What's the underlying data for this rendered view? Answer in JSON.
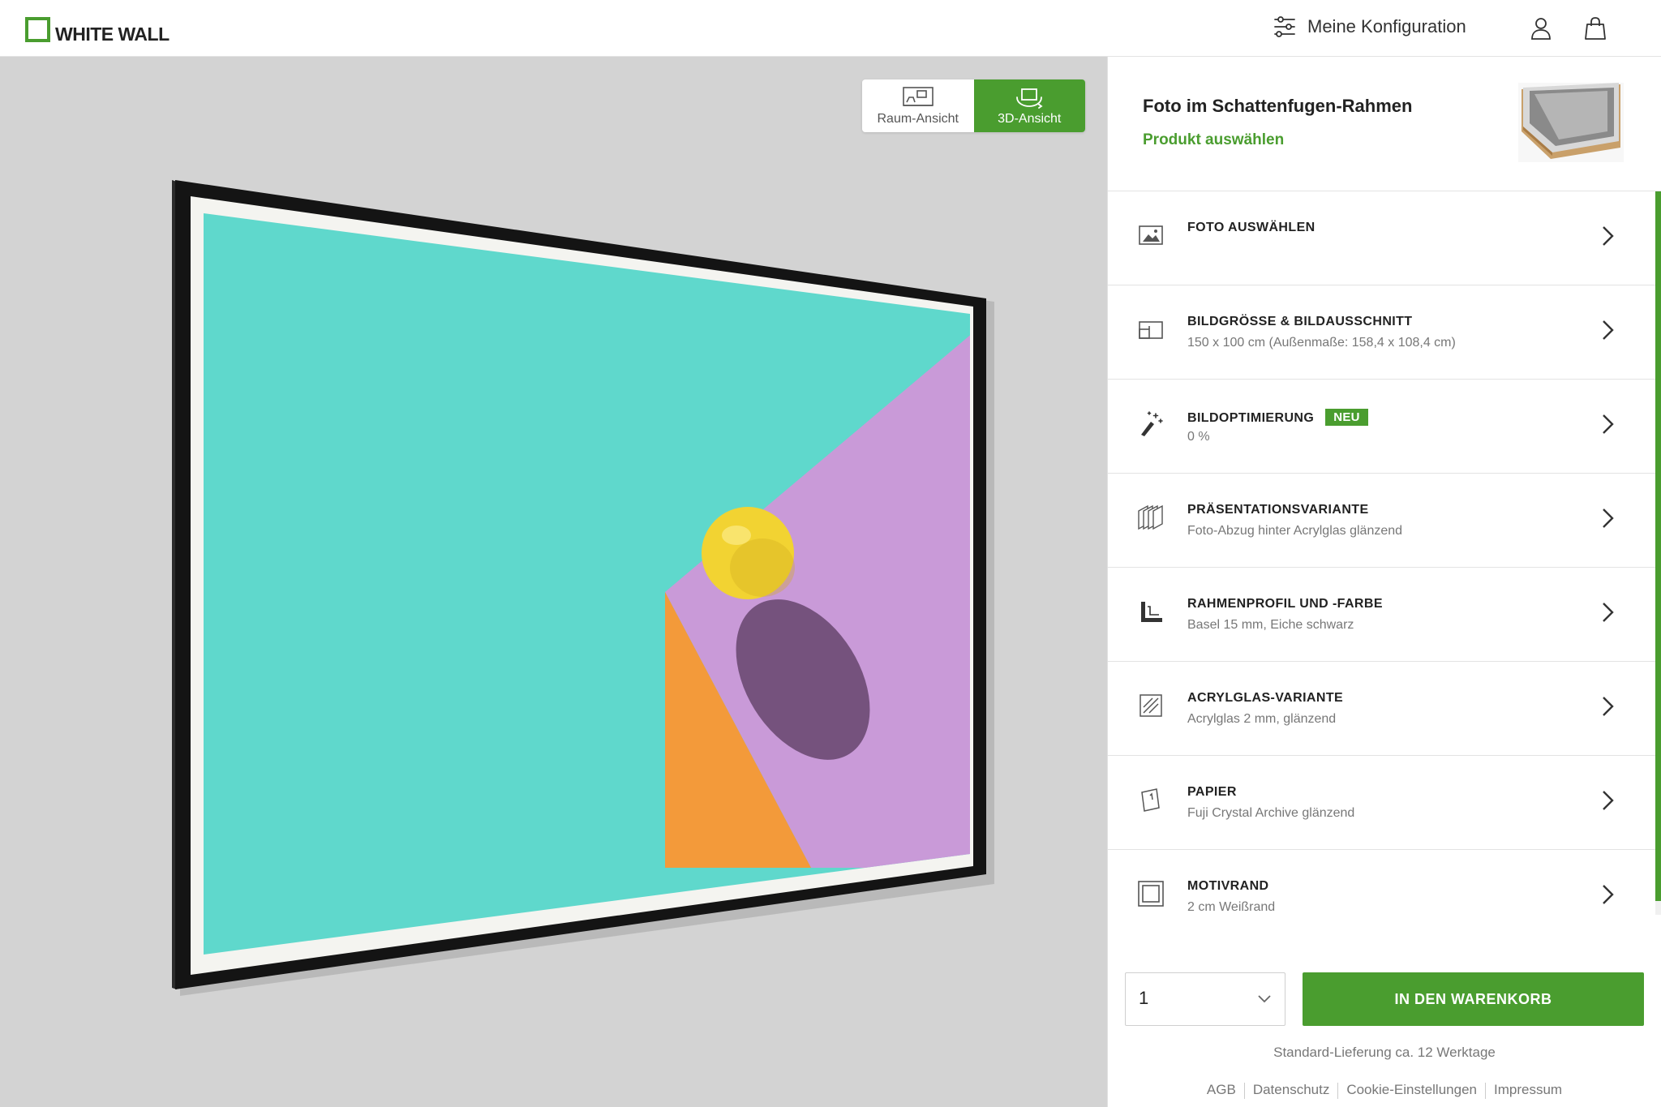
{
  "brand": {
    "name": "WHITE WALL",
    "accent_color": "#4a9d2f"
  },
  "header": {
    "config_label": "Meine Konfiguration",
    "config_icon": "sliders-icon",
    "account_icon": "user-icon",
    "cart_icon": "shopping-bag-icon"
  },
  "viewer": {
    "toggle": [
      {
        "label": "Raum-Ansicht",
        "icon": "room-view-icon",
        "active": false
      },
      {
        "label": "3D-Ansicht",
        "icon": "3d-rotate-icon",
        "active": true
      }
    ],
    "artwork_colors": {
      "turquoise": "#5fd8cc",
      "lilac": "#c99ad8",
      "orange": "#f39a3a",
      "ball": "#f2d332"
    }
  },
  "product": {
    "title": "Foto im Schattenfugen-Rahmen",
    "select_label": "Produkt auswählen"
  },
  "options": [
    {
      "title": "FOTO AUSWÄHLEN",
      "subtitle": "",
      "icon": "image-icon"
    },
    {
      "title": "BILDGRÖSSE & BILDAUSSCHNITT",
      "subtitle": "150 x 100 cm (Außenmaße: 158,4 x 108,4 cm)",
      "icon": "crop-size-icon"
    },
    {
      "title": "BILDOPTIMIERUNG",
      "subtitle": "0 %",
      "icon": "magic-wand-icon",
      "badge": "NEU"
    },
    {
      "title": "PRÄSENTATIONSVARIANTE",
      "subtitle": "Foto-Abzug hinter Acrylglas glänzend",
      "icon": "layers-icon"
    },
    {
      "title": "RAHMENPROFIL UND -FARBE",
      "subtitle": "Basel 15 mm, Eiche schwarz",
      "icon": "frame-profile-icon"
    },
    {
      "title": "ACRYLGLAS-VARIANTE",
      "subtitle": "Acrylglas 2 mm, glänzend",
      "icon": "acrylic-glass-icon"
    },
    {
      "title": "PAPIER",
      "subtitle": "Fuji Crystal Archive glänzend",
      "icon": "paper-icon"
    },
    {
      "title": "MOTIVRAND",
      "subtitle": "2 cm Weißrand",
      "icon": "border-icon"
    }
  ],
  "cart": {
    "quantity": "1",
    "add_label": "IN DEN WARENKORB",
    "delivery": "Standard-Lieferung ca. 12 Werktage"
  },
  "footer": {
    "links": [
      "AGB",
      "Datenschutz",
      "Cookie-Einstellungen",
      "Impressum"
    ]
  }
}
